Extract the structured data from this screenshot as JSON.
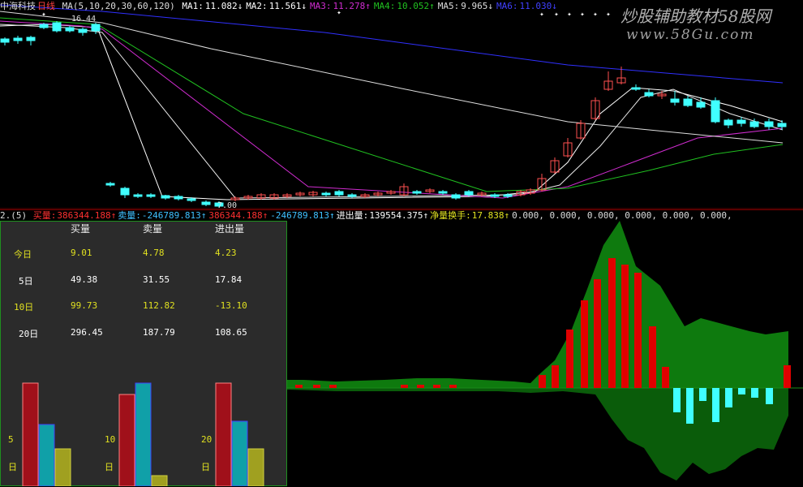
{
  "header": {
    "stock_name": "中海科技",
    "period": "日线",
    "ma_params": "MA(5,10,20,30,60,120)",
    "ma": [
      {
        "label": "MA1:",
        "value": "11.082↓",
        "color": "#ffffff"
      },
      {
        "label": "MA2:",
        "value": "11.561↓",
        "color": "#ffffff"
      },
      {
        "label": "MA3:",
        "value": "11.278↑",
        "color": "#d02cd0"
      },
      {
        "label": "MA4:",
        "value": "10.052↑",
        "color": "#20c020"
      },
      {
        "label": "MA5:",
        "value": "9.965↓",
        "color": "#dddddd"
      },
      {
        "label": "MA6:",
        "value": "11.030↓",
        "color": "#4040ff"
      }
    ]
  },
  "watermark": {
    "title": "炒股辅助教材58股网",
    "url": "www.58Gu.com"
  },
  "price_labels": {
    "high": "16.44",
    "low": "7.00"
  },
  "indicator_header": {
    "prefix": "2.(5)",
    "items": [
      {
        "label": "买量:",
        "value": "386344.188↑",
        "color": "#ff3030"
      },
      {
        "label": "卖量:",
        "value": "-246789.813↑",
        "color": "#40c0ff"
      },
      {
        "label": "",
        "value": "386344.188↑",
        "color": "#ff3030"
      },
      {
        "label": "",
        "value": "-246789.813↑",
        "color": "#40c0ff"
      },
      {
        "label": "进出量:",
        "value": "139554.375↑",
        "color": "#ffffff"
      },
      {
        "label": "净量换手:",
        "value": "17.838↑",
        "color": "#e0e020"
      },
      {
        "label": "",
        "value": "0.000, 0.000, 0.000, 0.000, 0.000, 0.000,",
        "color": "#dddddd"
      }
    ]
  },
  "panel": {
    "columns": [
      "买量",
      "卖量",
      "进出量"
    ],
    "rows": [
      {
        "label": "今日",
        "values": [
          "9.01",
          "4.78",
          "4.23"
        ],
        "color": "#e0e020"
      },
      {
        "label": "5日",
        "values": [
          "49.38",
          "31.55",
          "17.84"
        ],
        "color": "#ffffff"
      },
      {
        "label": "10日",
        "values": [
          "99.73",
          "112.82",
          "-13.10"
        ],
        "color": "#e0e020"
      },
      {
        "label": "20日",
        "values": [
          "296.45",
          "187.79",
          "108.65"
        ],
        "color": "#ffffff"
      }
    ],
    "bar_groups": [
      {
        "label_num": "5",
        "label_day": "日",
        "values": [
          0.95,
          0.57,
          0.34
        ]
      },
      {
        "label_num": "10",
        "label_day": "日",
        "values": [
          0.84,
          0.95,
          0.1
        ]
      },
      {
        "label_num": "20",
        "label_day": "日",
        "values": [
          0.95,
          0.6,
          0.34
        ]
      }
    ]
  },
  "colors": {
    "up": "#ff5050",
    "down": "#40ffff",
    "green_fill": "#0e7a0e",
    "red_bar": "#e00000"
  }
}
